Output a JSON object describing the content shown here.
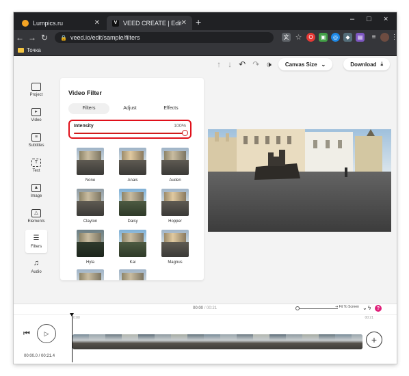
{
  "browser": {
    "tabs": [
      {
        "label": "Lumpics.ru",
        "active": false
      },
      {
        "label": "VEED CREATE | Edit",
        "active": true
      }
    ],
    "new_tab": "+",
    "window_controls": [
      "–",
      "□",
      "×"
    ],
    "url": "veed.io/edit/sample/filters",
    "bookmark": "Точка"
  },
  "toolbar": {
    "canvas_size_label": "Canvas Size",
    "download_label": "Download"
  },
  "sidebar": {
    "items": [
      {
        "label": "Project",
        "icon": "project-icon"
      },
      {
        "label": "Video",
        "icon": "video-icon"
      },
      {
        "label": "Subtitles",
        "icon": "subtitles-icon"
      },
      {
        "label": "Text",
        "icon": "text-icon"
      },
      {
        "label": "Image",
        "icon": "image-icon"
      },
      {
        "label": "Elements",
        "icon": "elements-icon"
      },
      {
        "label": "Filters",
        "icon": "filters-icon",
        "selected": true
      },
      {
        "label": "Audio",
        "icon": "audio-icon"
      }
    ]
  },
  "panel": {
    "title": "Video Filter",
    "tabs": [
      "Filters",
      "Adjust",
      "Effects"
    ],
    "active_tab": "Filters",
    "intensity_label": "Intensity",
    "intensity_value": "100%",
    "intensity_fraction": 1.0,
    "filters": [
      "None",
      "Anais",
      "Auden",
      "Clayton",
      "Daisy",
      "Hopper",
      "Hyla",
      "Kai",
      "Magnus"
    ]
  },
  "timeline": {
    "current_time": "00:00",
    "total_time": "00:21",
    "ruler_start": "0:00",
    "ruler_end": "00:21",
    "fit_to_screen": "Fit To Screen",
    "help": "?",
    "timecode": "00:00.0 / 00:21.4"
  },
  "colors": {
    "highlight": "#e0101a",
    "slider": "#d01a1a",
    "help_badge": "#e0207a"
  }
}
